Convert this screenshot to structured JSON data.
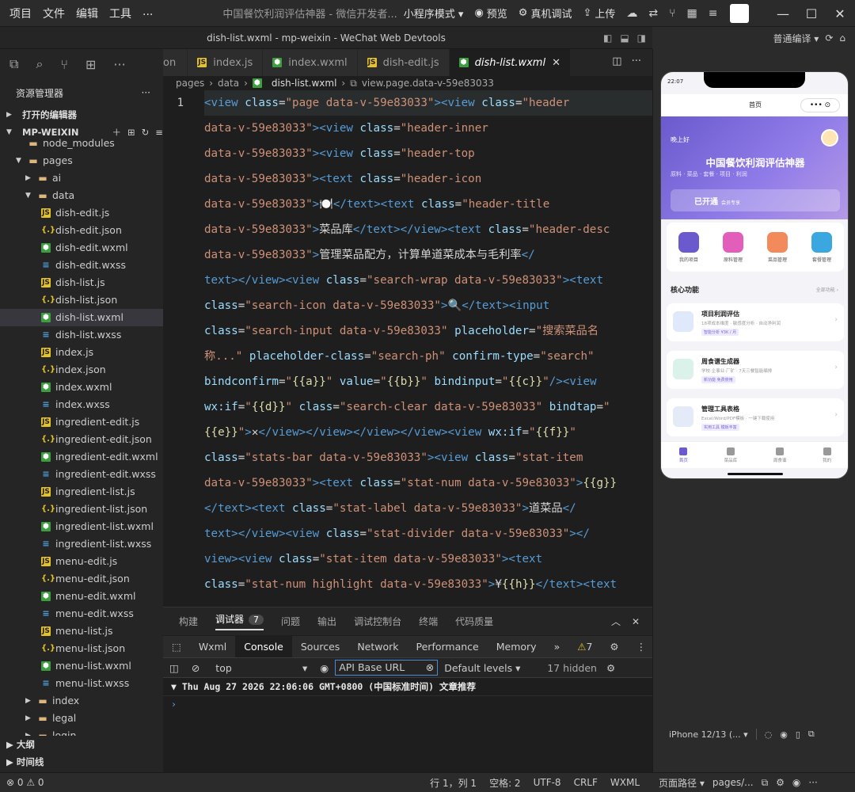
{
  "titlebar": {
    "menus": [
      "项目",
      "文件",
      "编辑",
      "工具",
      "..."
    ],
    "app_title": "中国餐饮利润评估神器",
    "developer": "微信开发者...",
    "mode": "小程序模式",
    "buttons": {
      "preview": "预览",
      "device_debug": "真机调试",
      "upload": "上传"
    }
  },
  "subheader": {
    "title": "dish-list.wxml - mp-weixin - WeChat Web Devtools"
  },
  "sim_header": {
    "compile_mode": "普通编译"
  },
  "explorer": {
    "title": "资源管理器",
    "open_editors": "打开的编辑器",
    "project": "MP-WEIXIN",
    "items": [
      {
        "name": "node_modules",
        "type": "folder",
        "depth": 1,
        "chevron": ""
      },
      {
        "name": "pages",
        "type": "folder",
        "depth": 1,
        "chevron": "▼"
      },
      {
        "name": "ai",
        "type": "folder",
        "depth": 2,
        "chevron": "▶"
      },
      {
        "name": "data",
        "type": "folder",
        "depth": 2,
        "chevron": "▼"
      },
      {
        "name": "dish-edit.js",
        "type": "js",
        "depth": 3
      },
      {
        "name": "dish-edit.json",
        "type": "json",
        "depth": 3
      },
      {
        "name": "dish-edit.wxml",
        "type": "wxml",
        "depth": 3
      },
      {
        "name": "dish-edit.wxss",
        "type": "wxss",
        "depth": 3
      },
      {
        "name": "dish-list.js",
        "type": "js",
        "depth": 3
      },
      {
        "name": "dish-list.json",
        "type": "json",
        "depth": 3
      },
      {
        "name": "dish-list.wxml",
        "type": "wxml",
        "depth": 3,
        "selected": true
      },
      {
        "name": "dish-list.wxss",
        "type": "wxss",
        "depth": 3
      },
      {
        "name": "index.js",
        "type": "js",
        "depth": 3
      },
      {
        "name": "index.json",
        "type": "json",
        "depth": 3
      },
      {
        "name": "index.wxml",
        "type": "wxml",
        "depth": 3
      },
      {
        "name": "index.wxss",
        "type": "wxss",
        "depth": 3
      },
      {
        "name": "ingredient-edit.js",
        "type": "js",
        "depth": 3
      },
      {
        "name": "ingredient-edit.json",
        "type": "json",
        "depth": 3
      },
      {
        "name": "ingredient-edit.wxml",
        "type": "wxml",
        "depth": 3
      },
      {
        "name": "ingredient-edit.wxss",
        "type": "wxss",
        "depth": 3
      },
      {
        "name": "ingredient-list.js",
        "type": "js",
        "depth": 3
      },
      {
        "name": "ingredient-list.json",
        "type": "json",
        "depth": 3
      },
      {
        "name": "ingredient-list.wxml",
        "type": "wxml",
        "depth": 3
      },
      {
        "name": "ingredient-list.wxss",
        "type": "wxss",
        "depth": 3
      },
      {
        "name": "menu-edit.js",
        "type": "js",
        "depth": 3
      },
      {
        "name": "menu-edit.json",
        "type": "json",
        "depth": 3
      },
      {
        "name": "menu-edit.wxml",
        "type": "wxml",
        "depth": 3
      },
      {
        "name": "menu-edit.wxss",
        "type": "wxss",
        "depth": 3
      },
      {
        "name": "menu-list.js",
        "type": "js",
        "depth": 3
      },
      {
        "name": "menu-list.json",
        "type": "json",
        "depth": 3
      },
      {
        "name": "menu-list.wxml",
        "type": "wxml",
        "depth": 3
      },
      {
        "name": "menu-list.wxss",
        "type": "wxss",
        "depth": 3
      },
      {
        "name": "index",
        "type": "folder",
        "depth": 2,
        "chevron": "▶"
      },
      {
        "name": "legal",
        "type": "folder",
        "depth": 2,
        "chevron": "▶"
      },
      {
        "name": "login",
        "type": "folder",
        "depth": 2,
        "chevron": "▶"
      }
    ],
    "outline": "大纲",
    "timeline": "时间线"
  },
  "tabs": [
    {
      "label": "on",
      "type": "none"
    },
    {
      "label": "index.js",
      "type": "js"
    },
    {
      "label": "index.wxml",
      "type": "wxml"
    },
    {
      "label": "dish-edit.js",
      "type": "js"
    },
    {
      "label": "dish-list.wxml",
      "type": "wxml",
      "active": true
    }
  ],
  "breadcrumb": [
    "pages",
    "data",
    "dish-list.wxml",
    "view.page.data-v-59e83033"
  ],
  "editor": {
    "line_number": "1",
    "lines": [
      [
        [
          "t-tag",
          "<view "
        ],
        [
          "t-attr",
          "class"
        ],
        [
          "t-txt",
          "="
        ],
        [
          "t-str",
          "\"page data-v-59e83033\""
        ],
        [
          "t-tag",
          "><view "
        ],
        [
          "t-attr",
          "class"
        ],
        [
          "t-txt",
          "="
        ],
        [
          "t-str",
          "\"header"
        ]
      ],
      [
        [
          "t-str",
          "data-v-59e83033\""
        ],
        [
          "t-tag",
          "><view "
        ],
        [
          "t-attr",
          "class"
        ],
        [
          "t-txt",
          "="
        ],
        [
          "t-str",
          "\"header-inner"
        ]
      ],
      [
        [
          "t-str",
          "data-v-59e83033\""
        ],
        [
          "t-tag",
          "><view "
        ],
        [
          "t-attr",
          "class"
        ],
        [
          "t-txt",
          "="
        ],
        [
          "t-str",
          "\"header-top"
        ]
      ],
      [
        [
          "t-str",
          "data-v-59e83033\""
        ],
        [
          "t-tag",
          "><text "
        ],
        [
          "t-attr",
          "class"
        ],
        [
          "t-txt",
          "="
        ],
        [
          "t-str",
          "\"header-icon"
        ]
      ],
      [
        [
          "t-str",
          "data-v-59e83033\""
        ],
        [
          "t-tag",
          ">"
        ],
        [
          "t-txt",
          "🍽️"
        ],
        [
          "t-tag",
          "</text><text "
        ],
        [
          "t-attr",
          "class"
        ],
        [
          "t-txt",
          "="
        ],
        [
          "t-str",
          "\"header-title"
        ]
      ],
      [
        [
          "t-str",
          "data-v-59e83033\""
        ],
        [
          "t-tag",
          ">"
        ],
        [
          "t-txt",
          "菜品库"
        ],
        [
          "t-tag",
          "</text></view><text "
        ],
        [
          "t-attr",
          "class"
        ],
        [
          "t-txt",
          "="
        ],
        [
          "t-str",
          "\"header-desc"
        ]
      ],
      [
        [
          "t-str",
          "data-v-59e83033\""
        ],
        [
          "t-tag",
          ">"
        ],
        [
          "t-txt",
          "管理菜品配方，计算单道菜成本与毛利率"
        ],
        [
          "t-tag",
          "</"
        ]
      ],
      [
        [
          "t-tag",
          "text></view><view "
        ],
        [
          "t-attr",
          "class"
        ],
        [
          "t-txt",
          "="
        ],
        [
          "t-str",
          "\"search-wrap data-v-59e83033\""
        ],
        [
          "t-tag",
          "><text"
        ]
      ],
      [
        [
          "t-attr",
          "class"
        ],
        [
          "t-txt",
          "="
        ],
        [
          "t-str",
          "\"search-icon data-v-59e83033\""
        ],
        [
          "t-tag",
          ">"
        ],
        [
          "t-txt",
          "🔍"
        ],
        [
          "t-tag",
          "</text><input"
        ]
      ],
      [
        [
          "t-attr",
          "class"
        ],
        [
          "t-txt",
          "="
        ],
        [
          "t-str",
          "\"search-input data-v-59e83033\" "
        ],
        [
          "t-attr",
          "placeholder"
        ],
        [
          "t-txt",
          "="
        ],
        [
          "t-str",
          "\"搜索菜品名"
        ]
      ],
      [
        [
          "t-str",
          "称...\" "
        ],
        [
          "t-attr",
          "placeholder-class"
        ],
        [
          "t-txt",
          "="
        ],
        [
          "t-str",
          "\"search-ph\" "
        ],
        [
          "t-attr",
          "confirm-type"
        ],
        [
          "t-txt",
          "="
        ],
        [
          "t-str",
          "\"search\""
        ]
      ],
      [
        [
          "t-attr",
          "bindconfirm"
        ],
        [
          "t-txt",
          "="
        ],
        [
          "t-str",
          "\""
        ],
        [
          "t-br",
          "{{a}}"
        ],
        [
          "t-str",
          "\" "
        ],
        [
          "t-attr",
          "value"
        ],
        [
          "t-txt",
          "="
        ],
        [
          "t-str",
          "\""
        ],
        [
          "t-br",
          "{{b}}"
        ],
        [
          "t-str",
          "\" "
        ],
        [
          "t-attr",
          "bindinput"
        ],
        [
          "t-txt",
          "="
        ],
        [
          "t-str",
          "\""
        ],
        [
          "t-br",
          "{{c}}"
        ],
        [
          "t-str",
          "\""
        ],
        [
          "t-tag",
          "/><view"
        ]
      ],
      [
        [
          "t-attr",
          "wx:if"
        ],
        [
          "t-txt",
          "="
        ],
        [
          "t-str",
          "\""
        ],
        [
          "t-br",
          "{{d}}"
        ],
        [
          "t-str",
          "\" "
        ],
        [
          "t-attr",
          "class"
        ],
        [
          "t-txt",
          "="
        ],
        [
          "t-str",
          "\"search-clear data-v-59e83033\" "
        ],
        [
          "t-attr",
          "bindtap"
        ],
        [
          "t-txt",
          "="
        ],
        [
          "t-str",
          "\""
        ]
      ],
      [
        [
          "t-br",
          "{{e}}"
        ],
        [
          "t-str",
          "\""
        ],
        [
          "t-tag",
          ">"
        ],
        [
          "t-txt",
          "✕"
        ],
        [
          "t-tag",
          "</view></view></view></view><view "
        ],
        [
          "t-attr",
          "wx:if"
        ],
        [
          "t-txt",
          "="
        ],
        [
          "t-str",
          "\""
        ],
        [
          "t-br",
          "{{f}}"
        ],
        [
          "t-str",
          "\""
        ]
      ],
      [
        [
          "t-attr",
          "class"
        ],
        [
          "t-txt",
          "="
        ],
        [
          "t-str",
          "\"stats-bar data-v-59e83033\""
        ],
        [
          "t-tag",
          "><view "
        ],
        [
          "t-attr",
          "class"
        ],
        [
          "t-txt",
          "="
        ],
        [
          "t-str",
          "\"stat-item"
        ]
      ],
      [
        [
          "t-str",
          "data-v-59e83033\""
        ],
        [
          "t-tag",
          "><text "
        ],
        [
          "t-attr",
          "class"
        ],
        [
          "t-txt",
          "="
        ],
        [
          "t-str",
          "\"stat-num data-v-59e83033\""
        ],
        [
          "t-tag",
          ">"
        ],
        [
          "t-br",
          "{{g}}"
        ]
      ],
      [
        [
          "t-tag",
          "</text><text "
        ],
        [
          "t-attr",
          "class"
        ],
        [
          "t-txt",
          "="
        ],
        [
          "t-str",
          "\"stat-label data-v-59e83033\""
        ],
        [
          "t-tag",
          ">"
        ],
        [
          "t-txt",
          "道菜品"
        ],
        [
          "t-tag",
          "</"
        ]
      ],
      [
        [
          "t-tag",
          "text></view><view "
        ],
        [
          "t-attr",
          "class"
        ],
        [
          "t-txt",
          "="
        ],
        [
          "t-str",
          "\"stat-divider data-v-59e83033\""
        ],
        [
          "t-tag",
          "></"
        ]
      ],
      [
        [
          "t-tag",
          "view><view "
        ],
        [
          "t-attr",
          "class"
        ],
        [
          "t-txt",
          "="
        ],
        [
          "t-str",
          "\"stat-item data-v-59e83033\""
        ],
        [
          "t-tag",
          "><text"
        ]
      ],
      [
        [
          "t-attr",
          "class"
        ],
        [
          "t-txt",
          "="
        ],
        [
          "t-str",
          "\"stat-num highlight data-v-59e83033\""
        ],
        [
          "t-tag",
          ">"
        ],
        [
          "t-txt",
          "¥"
        ],
        [
          "t-br",
          "{{h}}"
        ],
        [
          "t-tag",
          "</text><text"
        ]
      ]
    ]
  },
  "devtools": {
    "panel_tabs": [
      "构建",
      "调试器",
      "问题",
      "输出",
      "调试控制台",
      "终端",
      "代码质量"
    ],
    "debugger_badge": "7",
    "sub_tabs": [
      "Wxml",
      "Console",
      "Sources",
      "Network",
      "Performance",
      "Memory"
    ],
    "warning_count": "7",
    "context": "top",
    "filter_value": "API Base URL",
    "levels": "Default levels",
    "hidden": "17 hidden",
    "log_line": "Thu Aug 27 2026 22:06:06 GMT+0800 (中国标准时间) 文章推荐",
    "prompt": "›"
  },
  "status": {
    "problems": "0",
    "warnings": "0",
    "position": "行 1，列 1",
    "spaces": "空格: 2",
    "encoding": "UTF-8",
    "eol": "CRLF",
    "language": "WXML"
  },
  "simulator": {
    "time": "22:07",
    "nav_title": "首页",
    "greeting": "晚上好",
    "title": "中国餐饮利润评估神器",
    "subtitle": "原料 · 菜品 · 套餐 · 项目 · 利润",
    "vip": "已开通",
    "vip_sub": "会员专享",
    "grid": [
      {
        "label": "我的项目",
        "color": "#6a5acd"
      },
      {
        "label": "原料管理",
        "color": "#e35dbb"
      },
      {
        "label": "菜品管理",
        "color": "#f28a5c"
      },
      {
        "label": "套餐管理",
        "color": "#3aa7e0"
      }
    ],
    "section": "核心功能",
    "section_more": "全部功能 ›",
    "cards": [
      {
        "title": "项目利润评估",
        "desc": "18项成本维度 · 敏感度分析 · 自动净利润",
        "tag": "智能分析  ¥3K / 月",
        "color": "#dfe9fb"
      },
      {
        "title": "周食谱生成器",
        "desc": "学校·企事业·厂矿 · 7天三餐智能编排",
        "tag": "新功能  免费使用",
        "color": "#dbf2ea"
      },
      {
        "title": "管理工具表格",
        "desc": "Excel/Word/PDF模板 · 一键下载使用",
        "tag": "实用工具  模板丰富",
        "color": "#e4eaf7"
      }
    ],
    "tabbar": [
      "首页",
      "菜品库",
      "周食谱",
      "我的"
    ],
    "device": "iPhone 12/13 (...",
    "page_path_label": "页面路径",
    "page_path": "pages/..."
  }
}
